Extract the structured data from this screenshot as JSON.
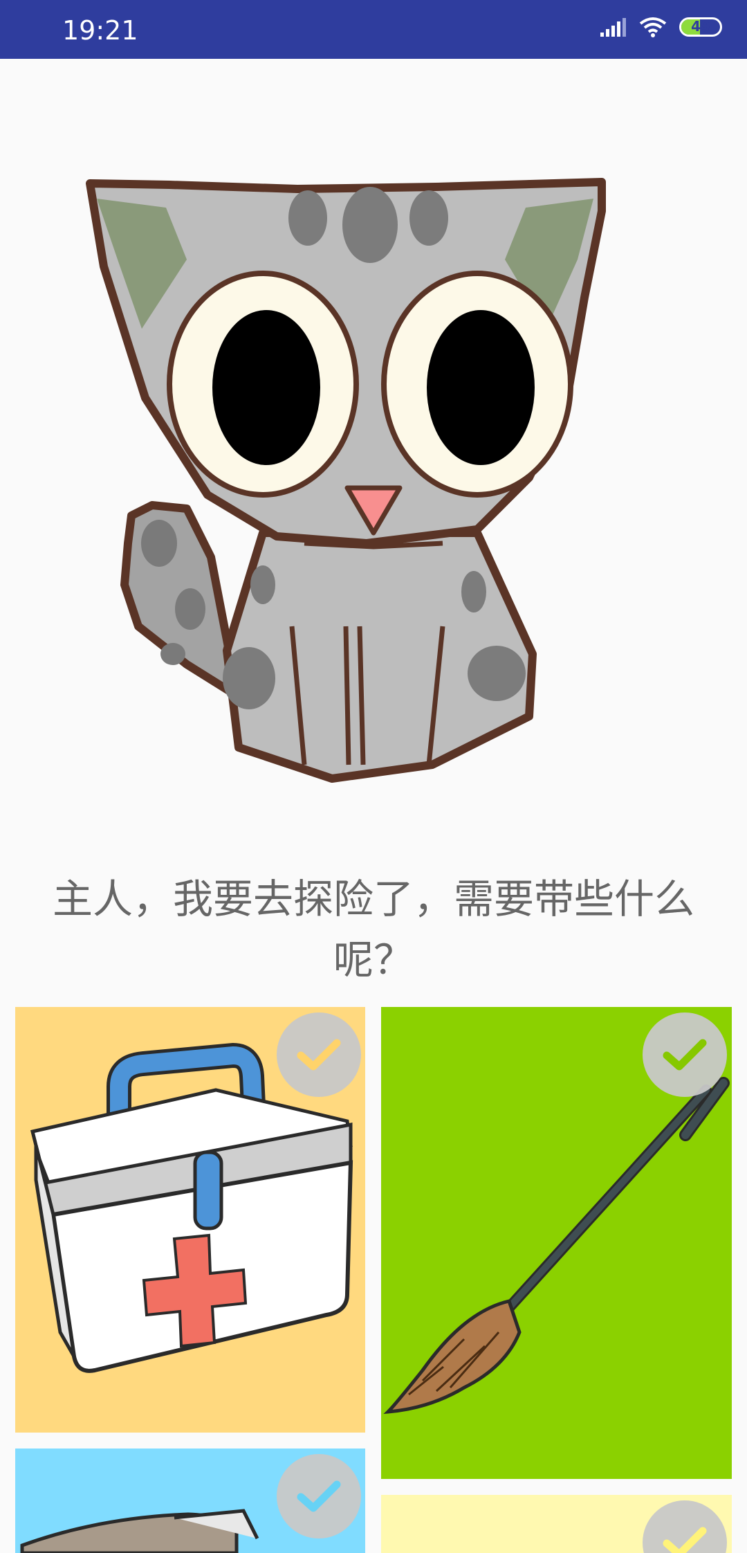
{
  "status_bar": {
    "time": "19:21",
    "battery": "49",
    "battery_level": 0.49
  },
  "prompt": {
    "text": "主人，我要去探险了，需要带些什么呢？"
  },
  "colors": {
    "status_bar_bg": "#2f3d9e",
    "card_medkit_bg": "#ffd97f",
    "card_broom_bg": "#8bd100",
    "card_blue_bg": "#80dcff",
    "card_yellow_bg": "#fff9b0",
    "check_medkit": "#ffd36a",
    "check_broom": "#86c800",
    "check_blue": "#67d2f5",
    "check_yellow": "#fff37a"
  },
  "items": [
    {
      "name": "first-aid-kit",
      "icon": "first-aid-kit-icon",
      "selected": false
    },
    {
      "name": "broom",
      "icon": "broom-icon",
      "selected": false
    },
    {
      "name": "blue-card-item",
      "icon": "object-icon",
      "selected": false
    },
    {
      "name": "yellow-card-item",
      "icon": "object-icon",
      "selected": false
    }
  ]
}
